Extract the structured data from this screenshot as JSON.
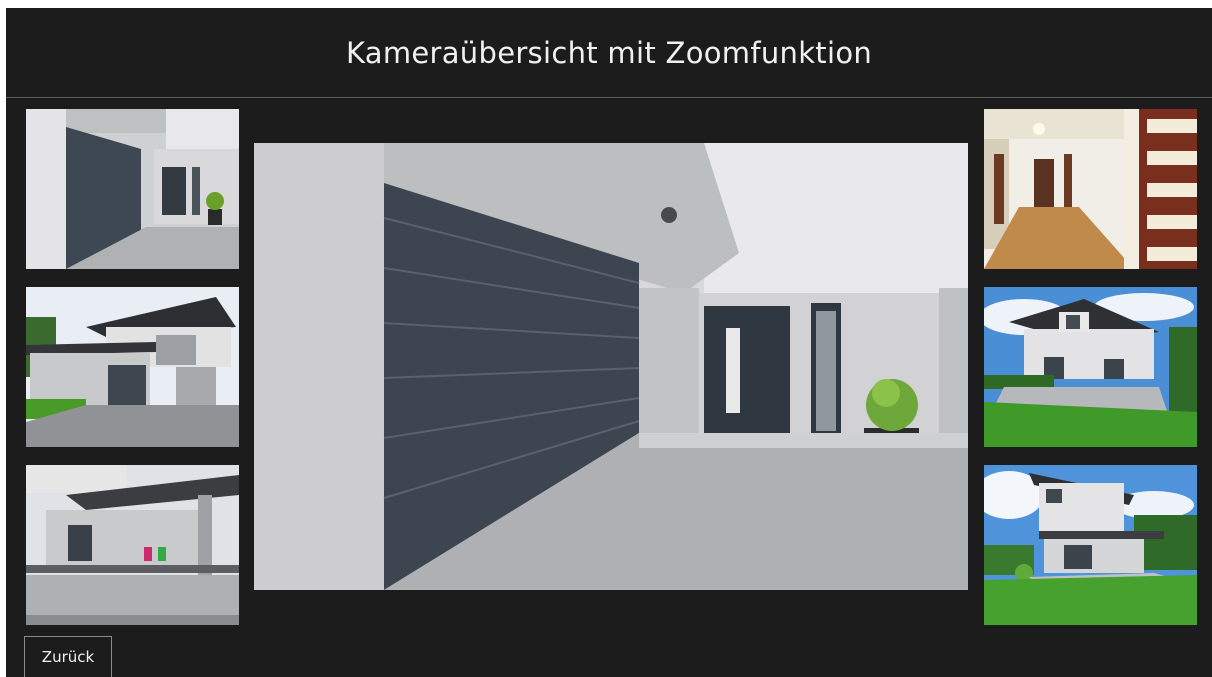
{
  "header": {
    "title": "Kameraübersicht mit Zoomfunktion"
  },
  "cameras": {
    "main": {
      "icon": "garage-door-closeup"
    },
    "left": [
      {
        "icon": "garage-entrance"
      },
      {
        "icon": "house-with-garage"
      },
      {
        "icon": "house-terrace"
      }
    ],
    "right": [
      {
        "icon": "hallway-interior"
      },
      {
        "icon": "house-garden-side"
      },
      {
        "icon": "house-garden-rear"
      }
    ]
  },
  "footer": {
    "back_label": "Zurück"
  },
  "colors": {
    "background": "#1c1c1c",
    "text": "#f0f0f0",
    "garage_door": "#3d4650",
    "wall": "#d6d6d6",
    "lawn": "#3f9a2a",
    "sky": "#4a8fd6"
  }
}
